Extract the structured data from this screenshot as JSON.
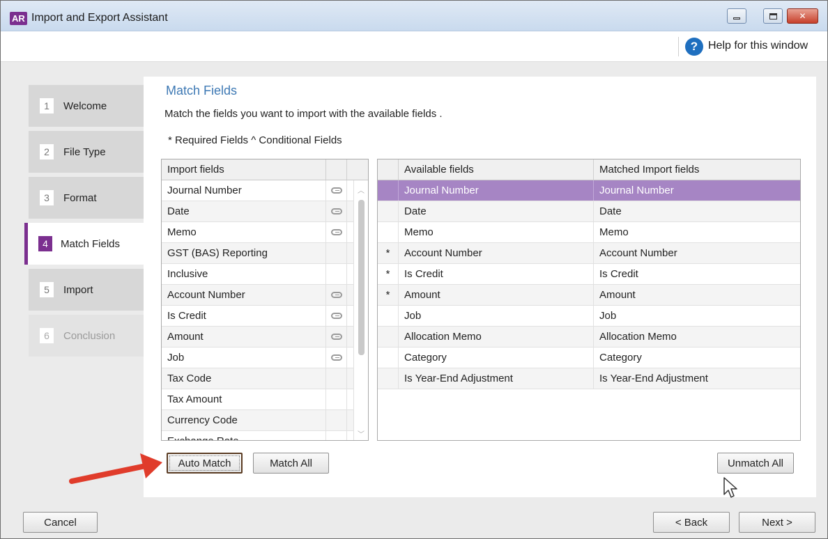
{
  "window": {
    "logo": "AR",
    "title": "Import and Export Assistant",
    "help_label": "Help for this window"
  },
  "steps": [
    {
      "num": "1",
      "label": "Welcome",
      "state": "normal"
    },
    {
      "num": "2",
      "label": "File Type",
      "state": "normal"
    },
    {
      "num": "3",
      "label": "Format",
      "state": "normal"
    },
    {
      "num": "4",
      "label": "Match Fields",
      "state": "active"
    },
    {
      "num": "5",
      "label": "Import",
      "state": "normal"
    },
    {
      "num": "6",
      "label": "Conclusion",
      "state": "disabled"
    }
  ],
  "panel": {
    "title": "Match Fields",
    "instructions": "Match the fields you want to import with the available fields .",
    "legend": "* Required Fields ^ Conditional Fields"
  },
  "import_table": {
    "header": "Import fields",
    "rows": [
      {
        "name": "Journal Number",
        "linked": true
      },
      {
        "name": "Date",
        "linked": true
      },
      {
        "name": "Memo",
        "linked": true
      },
      {
        "name": "GST (BAS) Reporting",
        "linked": false
      },
      {
        "name": "Inclusive",
        "linked": false
      },
      {
        "name": "Account Number",
        "linked": true
      },
      {
        "name": "Is Credit",
        "linked": true
      },
      {
        "name": "Amount",
        "linked": true
      },
      {
        "name": "Job",
        "linked": true
      },
      {
        "name": "Tax Code",
        "linked": false
      },
      {
        "name": "Tax Amount",
        "linked": false
      },
      {
        "name": "Currency Code",
        "linked": false
      },
      {
        "name": "Exchange Rate",
        "linked": false
      }
    ]
  },
  "available_table": {
    "header_available": "Available fields",
    "header_matched": "Matched Import fields",
    "rows": [
      {
        "marker": "",
        "field": "Journal Number",
        "matched": "Journal Number",
        "selected": true
      },
      {
        "marker": "",
        "field": "Date",
        "matched": "Date",
        "selected": false
      },
      {
        "marker": "",
        "field": "Memo",
        "matched": "Memo",
        "selected": false
      },
      {
        "marker": "*",
        "field": "Account Number",
        "matched": "Account Number",
        "selected": false
      },
      {
        "marker": "*",
        "field": "Is Credit",
        "matched": "Is Credit",
        "selected": false
      },
      {
        "marker": "*",
        "field": "Amount",
        "matched": "Amount",
        "selected": false
      },
      {
        "marker": "",
        "field": "Job",
        "matched": "Job",
        "selected": false
      },
      {
        "marker": "",
        "field": "Allocation Memo",
        "matched": "Allocation Memo",
        "selected": false
      },
      {
        "marker": "",
        "field": "Category",
        "matched": "Category",
        "selected": false
      },
      {
        "marker": "",
        "field": "Is Year-End Adjustment",
        "matched": "Is Year-End Adjustment",
        "selected": false
      }
    ]
  },
  "buttons": {
    "auto_match": "Auto Match",
    "match_all": "Match All",
    "unmatch_all": "Unmatch All",
    "cancel": "Cancel",
    "back": "< Back",
    "next": "Next >"
  },
  "colors": {
    "accent_purple": "#7b2f8f",
    "selected_row": "#a685c4",
    "title_blue": "#3e79b4",
    "annotation_red": "#e03c2b"
  }
}
